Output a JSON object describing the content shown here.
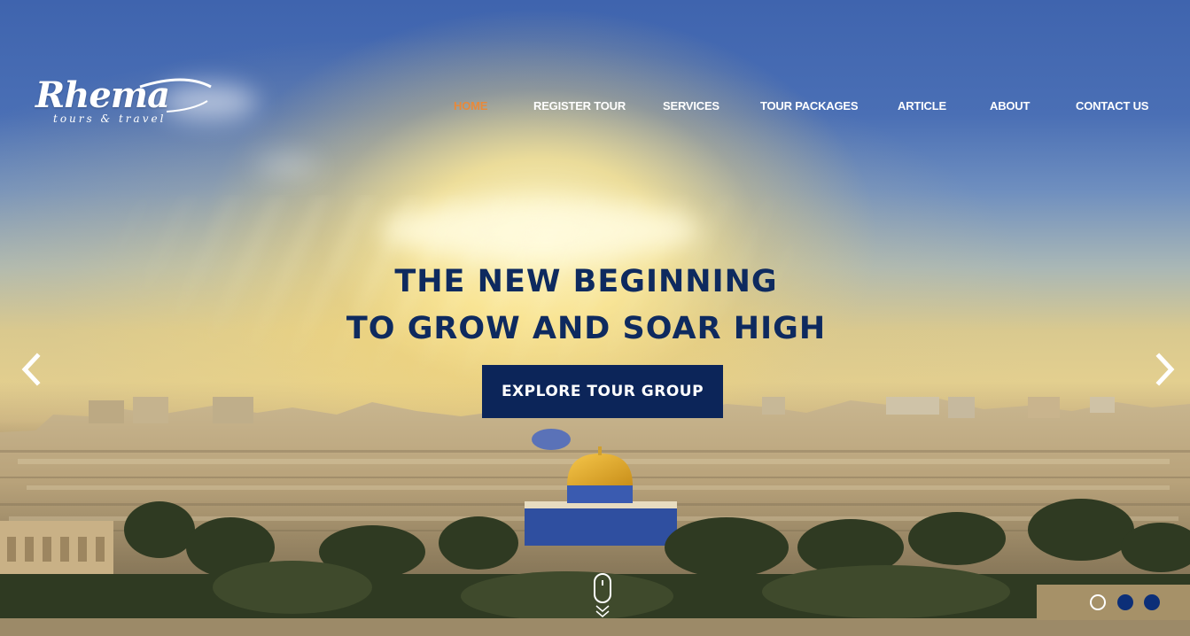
{
  "brand": {
    "name": "Rhema",
    "tagline": "tours & travel"
  },
  "nav": {
    "items": [
      {
        "label": "HOME",
        "active": true
      },
      {
        "label": "REGISTER TOUR",
        "active": false
      },
      {
        "label": "SERVICES",
        "active": false
      },
      {
        "label": "TOUR PACKAGES",
        "active": false
      },
      {
        "label": "ARTICLE",
        "active": false
      },
      {
        "label": "ABOUT",
        "active": false
      },
      {
        "label": "CONTACT US",
        "active": false
      }
    ]
  },
  "hero": {
    "headline_line1": "THE NEW BEGINNING",
    "headline_line2": "TO GROW AND SOAR HIGH",
    "cta_label": "EXPLORE TOUR GROUP",
    "prev_icon": "chevron-left-icon",
    "next_icon": "chevron-right-icon",
    "scroll_icon": "mouse-scroll-icon",
    "slide_count": 3,
    "active_slide": 1
  },
  "colors": {
    "nav_active": "#e8893a",
    "nav_text": "#ffffff",
    "headline": "#0e2a5f",
    "cta_bg": "#0c2559",
    "dot": "#0c2f78"
  }
}
